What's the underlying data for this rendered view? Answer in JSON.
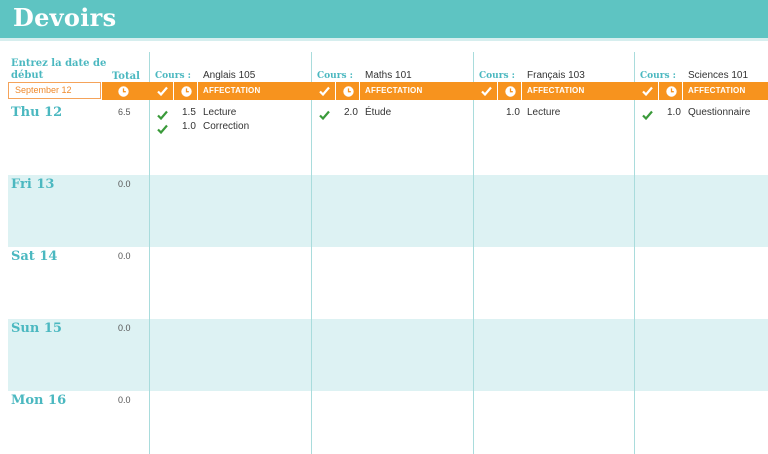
{
  "title": "Devoirs",
  "start_prompt": "Entrez la date de début",
  "start_date": "September 12",
  "total_label": "Total",
  "course_prefix": "Cours :",
  "assignment_header": "AFFECTATION",
  "icons": {
    "done": "checkmark-icon",
    "time": "clock-icon"
  },
  "colors": {
    "banner": "#5ec4c2",
    "accent": "#f7931e",
    "stripe": "#ddf2f3",
    "heading": "#4bb8c0",
    "check": "#3a9a3a"
  },
  "courses": [
    {
      "name": "Anglais 105"
    },
    {
      "name": "Maths 101"
    },
    {
      "name": "Français 103"
    },
    {
      "name": "Sciences 101"
    }
  ],
  "days": [
    {
      "label": "Thu 12",
      "total": "6.5"
    },
    {
      "label": "Fri 13",
      "total": "0.0"
    },
    {
      "label": "Sat 14",
      "total": "0.0"
    },
    {
      "label": "Sun 15",
      "total": "0.0"
    },
    {
      "label": "Mon 16",
      "total": "0.0"
    }
  ],
  "entries": {
    "c0_r0": {
      "done": true,
      "hours": "1.5",
      "task": "Lecture"
    },
    "c0_r1": {
      "done": true,
      "hours": "1.0",
      "task": "Correction"
    },
    "c1_r0": {
      "done": true,
      "hours": "2.0",
      "task": "Étude"
    },
    "c2_r0": {
      "done": false,
      "hours": "1.0",
      "task": "Lecture"
    },
    "c3_r0": {
      "done": true,
      "hours": "1.0",
      "task": "Questionnaire"
    }
  }
}
